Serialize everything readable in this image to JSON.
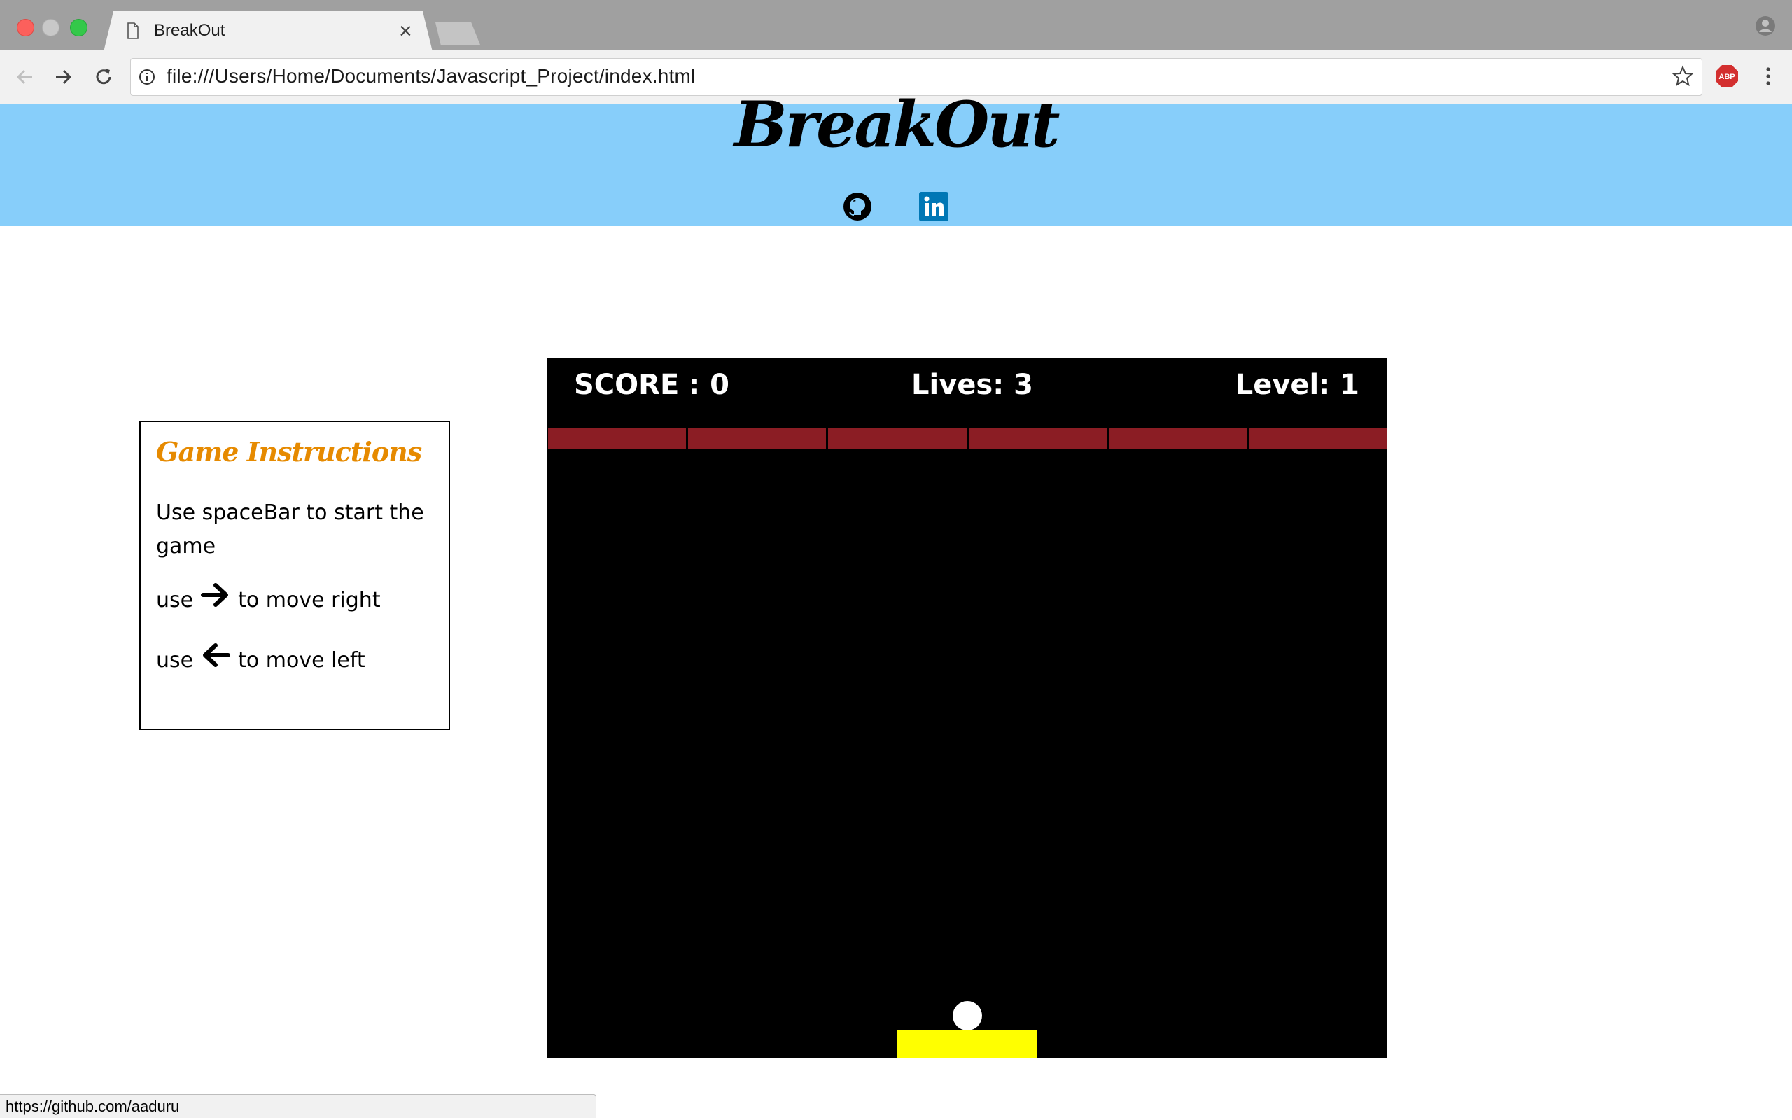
{
  "browser": {
    "tab_title": "BreakOut",
    "tab_close_label": "×",
    "url": "file:///Users/Home/Documents/Javascript_Project/index.html",
    "status_url": "https://github.com/aaduru",
    "abp_label": "ABP",
    "icons": [
      "back-icon",
      "forward-icon",
      "reload-icon",
      "info-icon",
      "star-icon",
      "adblock-plus-icon",
      "menu-icon",
      "profile-icon"
    ]
  },
  "page": {
    "title": "BreakOut",
    "header_bg": "#87cefa",
    "social_icons": [
      "github-icon",
      "linkedin-icon"
    ]
  },
  "instructions": {
    "title": "Game Instructions",
    "title_color": "#e68a00",
    "start_line": "Use spaceBar to start the game",
    "right_prefix": "use",
    "right_suffix": "to move right",
    "left_prefix": "use",
    "left_suffix": "to move left"
  },
  "game": {
    "score_text": "SCORE : 0",
    "lives_text": "Lives: 3",
    "level_text": "Level: 1",
    "brick_count": 6,
    "brick_color": "#8b1d24",
    "paddle_color": "#ffff00",
    "ball_color": "#ffffff"
  }
}
